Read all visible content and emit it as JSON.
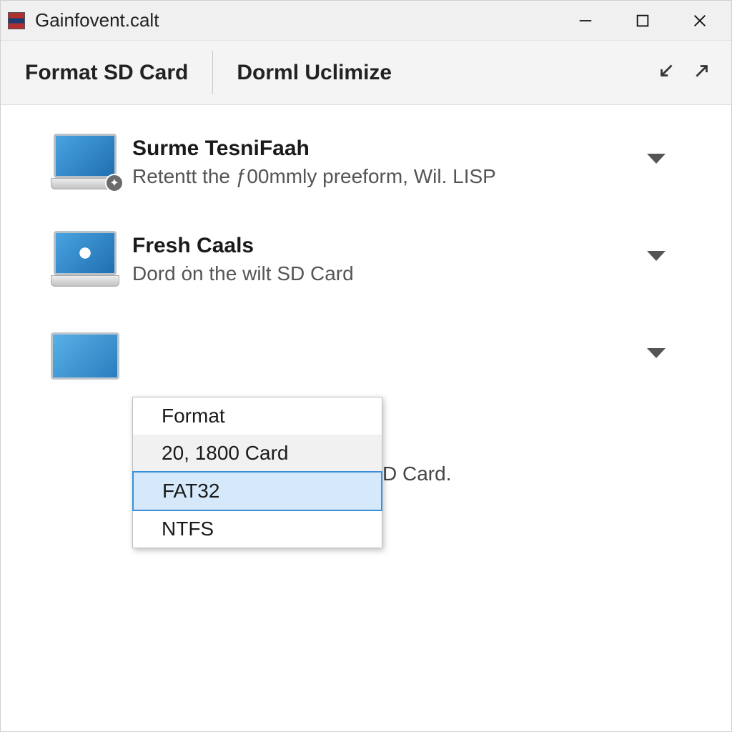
{
  "window": {
    "title": "Gainfovent.calt"
  },
  "tabs": {
    "0": {
      "label": "Format SD Card"
    },
    "1": {
      "label": "Dorml Uclimize"
    }
  },
  "items": [
    {
      "title": "Surme TesniFaah",
      "subtitle": "Retentt the ƒ00mmly preeform,  Wil. LISP"
    },
    {
      "title": "Fresh Caals",
      "subtitle": "Dord ȯn the wilt SD Card"
    },
    {
      "title": "",
      "subtitle": ""
    }
  ],
  "behind_text": "D Card.",
  "dropdown": {
    "options": [
      {
        "label": "Format"
      },
      {
        "label": "20, 1800 Card"
      },
      {
        "label": "FAT32"
      },
      {
        "label": "NTFS"
      }
    ]
  }
}
